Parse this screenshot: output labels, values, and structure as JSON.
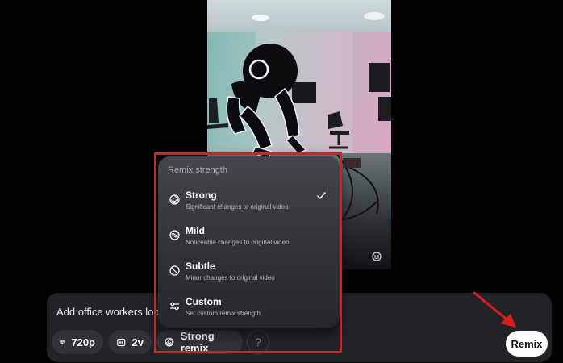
{
  "composer": {
    "prompt_text": "Add office workers looking at the robot",
    "quality_label": "720p",
    "variants_label": "2v",
    "remix_chip_label": "Strong remix",
    "help_label": "?",
    "submit_label": "Remix"
  },
  "menu": {
    "heading": "Remix strength",
    "items": [
      {
        "label": "Strong",
        "description": "Significant changes to original video",
        "icon": "strong-remix-icon",
        "selected": true
      },
      {
        "label": "Mild",
        "description": "Noticeable changes to original video",
        "icon": "mild-remix-icon",
        "selected": false
      },
      {
        "label": "Subtle",
        "description": "Minor changes to original video",
        "icon": "subtle-remix-icon",
        "selected": false
      },
      {
        "label": "Custom",
        "description": "Set custom remix strength",
        "icon": "sliders-icon",
        "selected": false
      }
    ]
  },
  "colors": {
    "background": "#000000",
    "composer_background": "#222326",
    "chip_background": "#313236",
    "annotation_red": "#e01b1b",
    "remix_button": "#ffffff"
  }
}
